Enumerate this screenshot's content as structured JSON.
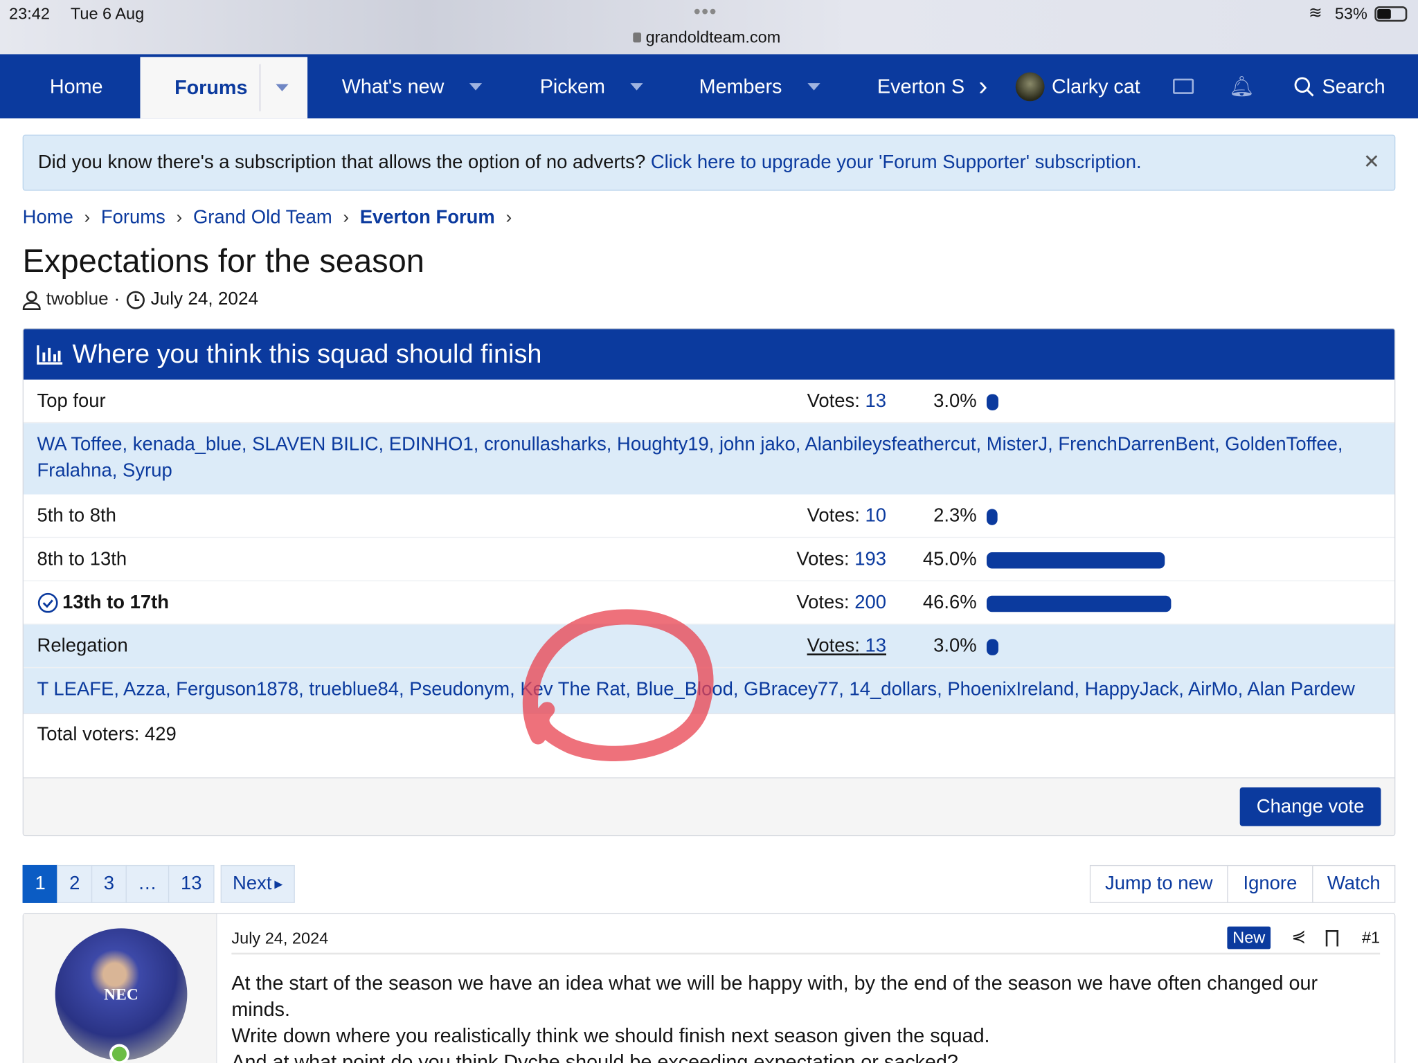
{
  "status_bar": {
    "time": "23:42",
    "date": "Tue 6 Aug",
    "url": "grandoldteam.com",
    "battery": "53%"
  },
  "nav": {
    "items": [
      {
        "label": "Home"
      },
      {
        "label": "Forums"
      },
      {
        "label": "What's new"
      },
      {
        "label": "Pickem"
      },
      {
        "label": "Members"
      },
      {
        "label": "Everton S"
      }
    ],
    "user": "Clarky cat",
    "search": "Search"
  },
  "notice": {
    "text": "Did you know there's a subscription that allows the option of no adverts?",
    "link": "Click here to upgrade your 'Forum Supporter' subscription.",
    "close": "✕"
  },
  "breadcrumb": [
    "Home",
    "Forums",
    "Grand Old Team",
    "Everton Forum"
  ],
  "thread": {
    "title": "Expectations for the season",
    "author": "twoblue",
    "date": "July 24, 2024"
  },
  "poll": {
    "title": "Where you think this squad should finish",
    "votes_label": "Votes:",
    "options": [
      {
        "label": "Top four",
        "votes": "13",
        "pct": "3.0%",
        "value": 3.0,
        "voters": "WA Toffee, kenada_blue, SLAVEN BILIC, EDINHO1, cronullasharks, Houghty19, john jako, Alanbileysfeathercut, MisterJ, FrenchDarrenBent, GoldenToffee, Fralahna, Syrup"
      },
      {
        "label": "5th to 8th",
        "votes": "10",
        "pct": "2.3%",
        "value": 2.3
      },
      {
        "label": "8th to 13th",
        "votes": "193",
        "pct": "45.0%",
        "value": 45.0
      },
      {
        "label": "13th to 17th",
        "votes": "200",
        "pct": "46.6%",
        "value": 46.6,
        "selected": true
      },
      {
        "label": "Relegation",
        "votes": "13",
        "pct": "3.0%",
        "value": 3.0,
        "voters": "T LEAFE, Azza, Ferguson1878, trueblue84, Pseudonym, Kev The Rat, Blue_Blood, GBracey77, 14_dollars, PhoenixIreland, HappyJack, AirMo, Alan Pardew"
      }
    ],
    "total": "Total voters: 429",
    "change_vote": "Change vote"
  },
  "pagination": {
    "pages": [
      "1",
      "2",
      "3",
      "…",
      "13"
    ],
    "next": "Next"
  },
  "thread_actions": [
    "Jump to new",
    "Ignore",
    "Watch"
  ],
  "post": {
    "date": "July 24, 2024",
    "badge": "New",
    "number": "#1",
    "avatar_text": "NEC",
    "lines": [
      "At the start of the season we have an idea what we will be happy with, by the end of the season we have often changed our minds.",
      "Write down where you realistically think we should finish next season given the squad.",
      "And at what point do you think Dyche should be exceeding expectation or sacked?"
    ]
  },
  "colors": {
    "brand": "#0b3a9e",
    "highlight": "#dcebf8",
    "annotation": "#e8424f"
  }
}
